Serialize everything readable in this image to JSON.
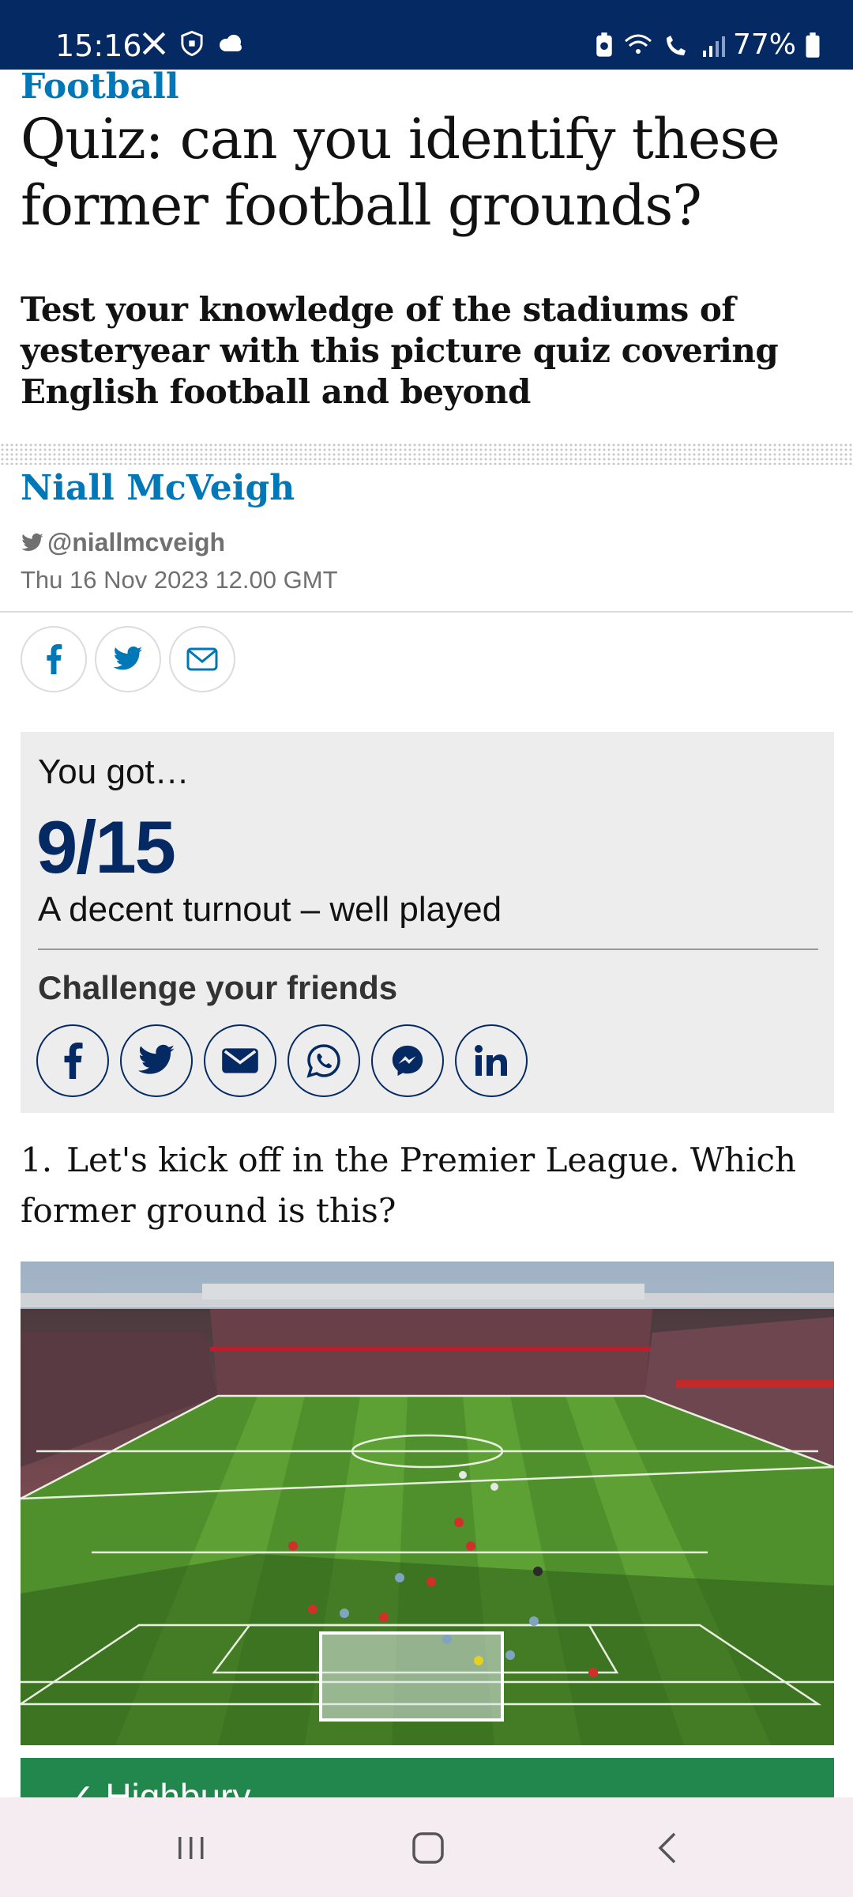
{
  "status_bar": {
    "time": "15:16",
    "battery": "77%",
    "left_icons": [
      "x-logo-icon",
      "shield-icon",
      "cloud-icon"
    ],
    "right_icons": [
      "battery-saver-icon",
      "wifi-icon",
      "wifi-calling-icon",
      "signal-icon",
      "battery-icon"
    ]
  },
  "article": {
    "section": "Football",
    "headline": "Quiz: can you identify these former football grounds?",
    "standfirst": "Test your knowledge of the stadiums of yesteryear with this picture quiz covering English football and beyond",
    "author": "Niall McVeigh",
    "twitter_handle": "@niallmcveigh",
    "date": "Thu 16 Nov 2023 12.00 GMT",
    "share_icons": [
      "facebook-icon",
      "twitter-icon",
      "email-icon"
    ]
  },
  "result": {
    "you_got": "You got…",
    "score": "9/15",
    "message": "A decent turnout – well played",
    "challenge": "Challenge your friends",
    "social": [
      "facebook",
      "twitter",
      "email",
      "whatsapp",
      "messenger",
      "linkedin"
    ]
  },
  "question": {
    "number": "1.",
    "text": "Let's kick off in the Premier League. Which former ground is this?",
    "answer": "Highbury"
  },
  "colors": {
    "status_bar": "#052962",
    "section": "#0077b6",
    "score": "#052962",
    "answer_correct": "#22874d",
    "nav_bar": "#f4ecf1"
  },
  "nav": {
    "buttons": [
      "recent-apps-icon",
      "home-icon",
      "back-icon"
    ]
  }
}
